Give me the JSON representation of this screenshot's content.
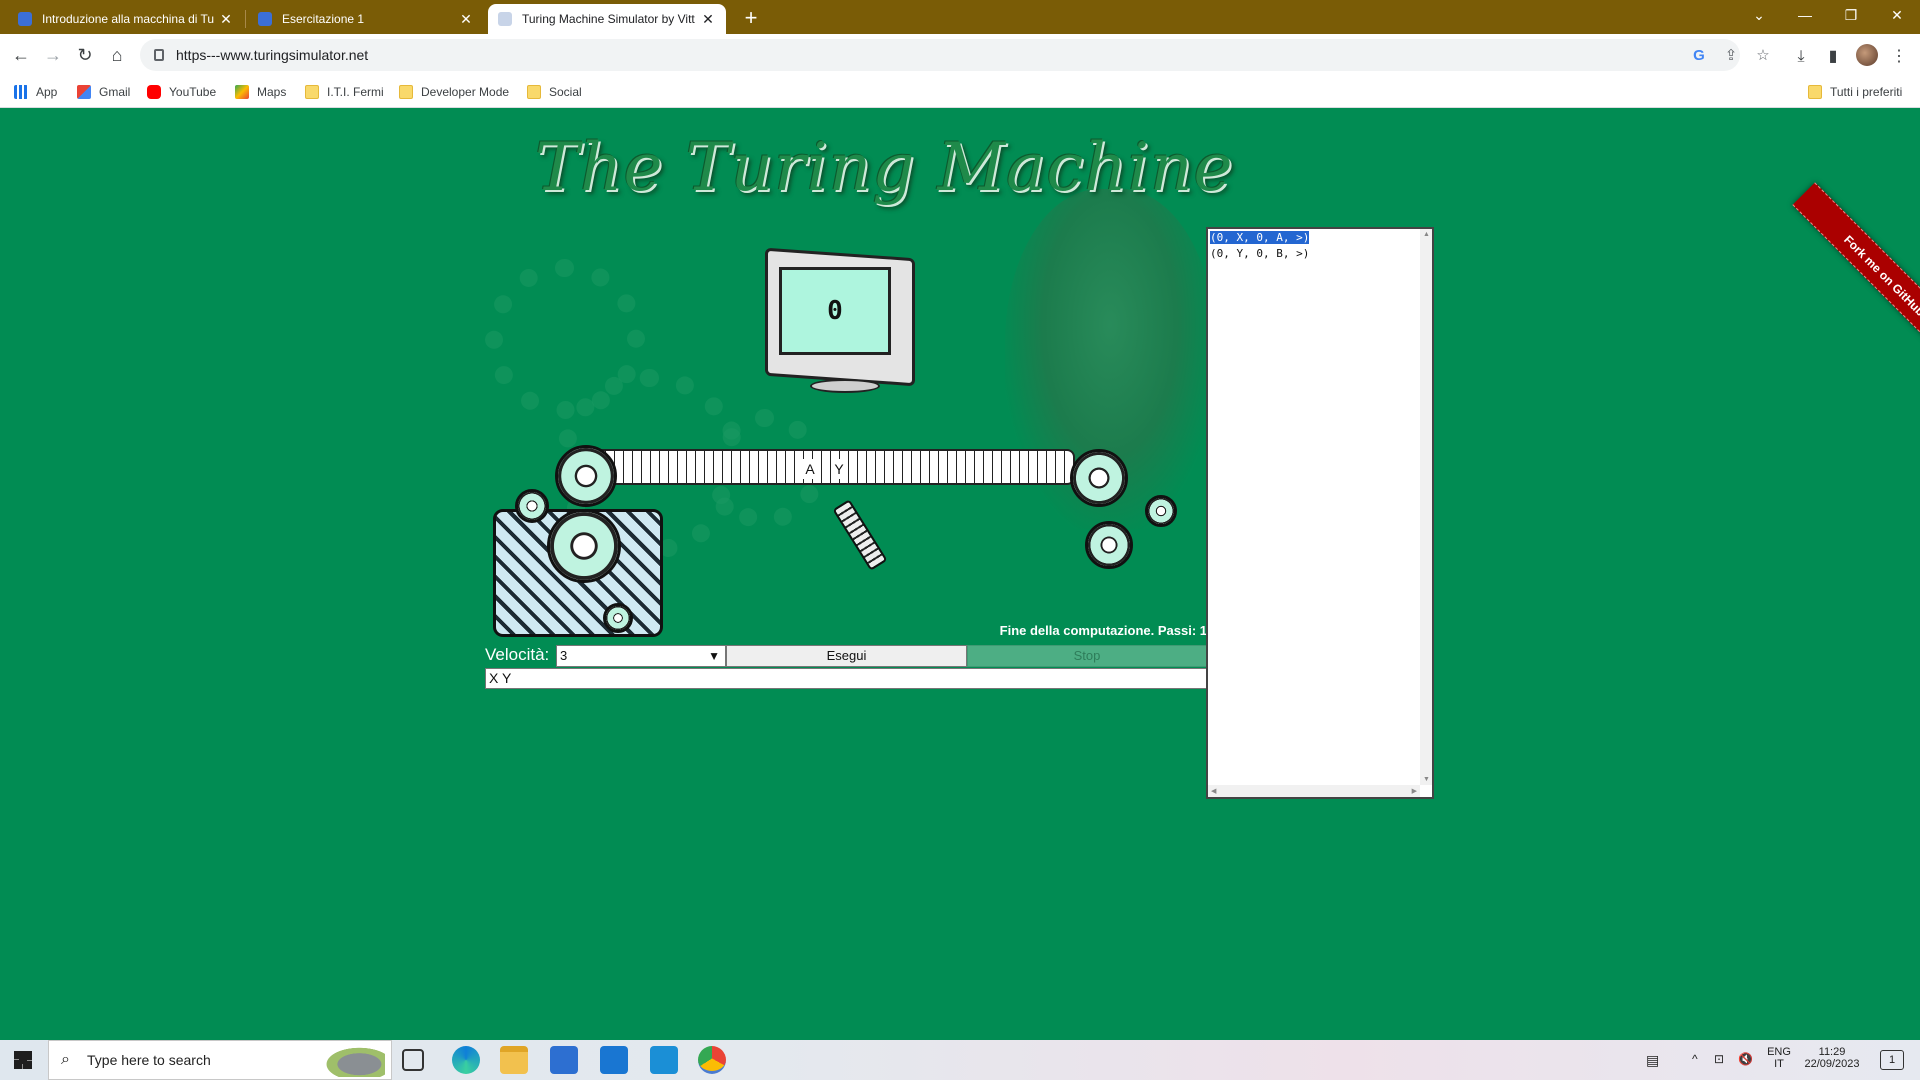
{
  "browser": {
    "tabs": [
      {
        "title": "Introduzione alla macchina di Tu",
        "active": false
      },
      {
        "title": "Esercitazione 1",
        "active": false
      },
      {
        "title": "Turing Machine Simulator by Vitt",
        "active": true
      }
    ],
    "new_tab_label": "+",
    "url": "https---www.turingsimulator.net",
    "bookmarks": [
      {
        "label": "App",
        "icon": "apps-icon"
      },
      {
        "label": "Gmail",
        "icon": "gmail-icon"
      },
      {
        "label": "YouTube",
        "icon": "youtube-icon"
      },
      {
        "label": "Maps",
        "icon": "maps-icon"
      },
      {
        "label": "I.T.I. Fermi",
        "icon": "folder-icon"
      },
      {
        "label": "Developer Mode",
        "icon": "folder-icon"
      },
      {
        "label": "Social",
        "icon": "folder-icon"
      }
    ],
    "other_bookmarks": "Tutti i preferiti"
  },
  "page": {
    "title_art": "The Turing Machine",
    "screen_state": "0",
    "tape_cells": [
      "A",
      "Y"
    ],
    "status": "Fine della computazione. Passi: 1",
    "speed_label": "Velocità:",
    "speed_value": "3",
    "run_label": "Esegui",
    "stop_label": "Stop",
    "tape_input": "X Y",
    "program": [
      {
        "text": "(0, X, 0, A, >)",
        "selected": true
      },
      {
        "text": "(0, Y, 0, B, >)",
        "selected": false
      }
    ],
    "ribbon": "Fork me on GitHub"
  },
  "taskbar": {
    "search_placeholder": "Type here to search",
    "lang_1": "ENG",
    "lang_2": "IT",
    "time": "11:29",
    "date": "22/09/2023",
    "notification_count": "1"
  },
  "colors": {
    "page_bg": "#018c53",
    "tabstrip_bg": "#7a5c06",
    "selection": "#2366d1",
    "ribbon": "#aa0000"
  }
}
